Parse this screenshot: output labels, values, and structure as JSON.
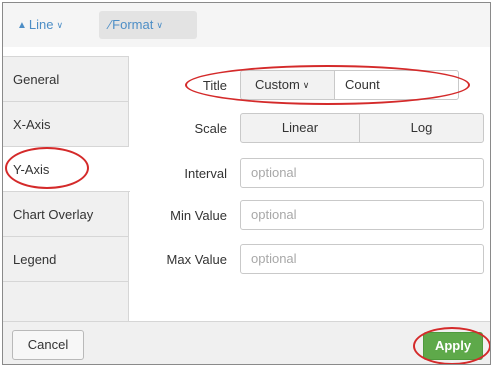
{
  "toolbar": {
    "viz_label": "Line",
    "format_label": "Format"
  },
  "sidebar": {
    "items": [
      {
        "label": "General"
      },
      {
        "label": "X-Axis"
      },
      {
        "label": "Y-Axis",
        "active": true
      },
      {
        "label": "Chart Overlay"
      },
      {
        "label": "Legend"
      }
    ]
  },
  "form": {
    "title": {
      "label": "Title",
      "mode": "Custom",
      "value": "Count"
    },
    "scale": {
      "label": "Scale",
      "options": [
        "Linear",
        "Log"
      ]
    },
    "interval": {
      "label": "Interval",
      "placeholder": "optional"
    },
    "min_value": {
      "label": "Min Value",
      "placeholder": "optional"
    },
    "max_value": {
      "label": "Max Value",
      "placeholder": "optional"
    }
  },
  "footer": {
    "cancel_label": "Cancel",
    "apply_label": "Apply"
  },
  "colors": {
    "accent_blue": "#4d8ec6",
    "apply_green": "#5ea94a",
    "annotation_red": "#d42a2a"
  }
}
